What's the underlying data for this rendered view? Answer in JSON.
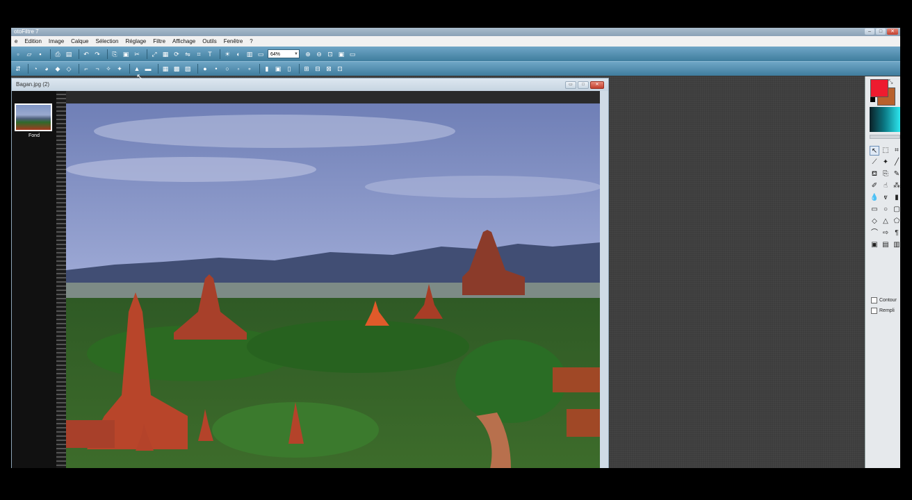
{
  "app": {
    "title": "otoFiltre 7",
    "window_buttons": [
      "–",
      "□",
      "✕"
    ]
  },
  "menu": {
    "items": [
      "e",
      "Edition",
      "Image",
      "Calque",
      "Sélection",
      "Réglage",
      "Filtre",
      "Affichage",
      "Outils",
      "Fenêtre",
      "?"
    ]
  },
  "toolbar": {
    "zoom_value": "64%"
  },
  "document": {
    "name": "Bagan.jpg (2)",
    "buttons": [
      "▭",
      "□",
      "✕"
    ]
  },
  "layers": {
    "items": [
      {
        "name": "Fond"
      }
    ]
  },
  "right_panel": {
    "fg_color": "#ee1b2f",
    "bg_color": "#b8612d",
    "gradient_start": "#0b2026",
    "gradient_end": "#2de6ee",
    "contour_label": "Contour",
    "fill_label": "Rempli"
  },
  "tools": [
    {
      "name": "selection-arrow-icon",
      "glyph": "↖"
    },
    {
      "name": "lasso-icon",
      "glyph": "⬚"
    },
    {
      "name": "crop-icon",
      "glyph": "⌗"
    },
    {
      "name": "eyedropper-icon",
      "glyph": "⟋"
    },
    {
      "name": "magic-wand-icon",
      "glyph": "✦"
    },
    {
      "name": "line-icon",
      "glyph": "╱"
    },
    {
      "name": "paint-bucket-icon",
      "glyph": "⛾"
    },
    {
      "name": "clone-icon",
      "glyph": "⎘"
    },
    {
      "name": "brush-icon",
      "glyph": "✎"
    },
    {
      "name": "pencil-icon",
      "glyph": "✐"
    },
    {
      "name": "smudge-icon",
      "glyph": "☝"
    },
    {
      "name": "spray-icon",
      "glyph": "⁂"
    },
    {
      "name": "blur-drop-icon",
      "glyph": "💧"
    },
    {
      "name": "dodge-icon",
      "glyph": "ⱴ"
    },
    {
      "name": "stamp-icon",
      "glyph": "▮"
    },
    {
      "name": "rectangle-icon",
      "glyph": "▭"
    },
    {
      "name": "ellipse-icon",
      "glyph": "○"
    },
    {
      "name": "rounded-rect-icon",
      "glyph": "▢"
    },
    {
      "name": "diamond-icon",
      "glyph": "◇"
    },
    {
      "name": "triangle-icon",
      "glyph": "△"
    },
    {
      "name": "polygon-icon",
      "glyph": "⬠"
    },
    {
      "name": "freeform-icon",
      "glyph": "⌒"
    },
    {
      "name": "arrow-shape-icon",
      "glyph": "⇨"
    },
    {
      "name": "text-shape-icon",
      "glyph": "¶"
    },
    {
      "name": "shape-option-1-icon",
      "glyph": "▣"
    },
    {
      "name": "shape-option-2-icon",
      "glyph": "▤"
    },
    {
      "name": "shape-option-3-icon",
      "glyph": "▥"
    }
  ]
}
